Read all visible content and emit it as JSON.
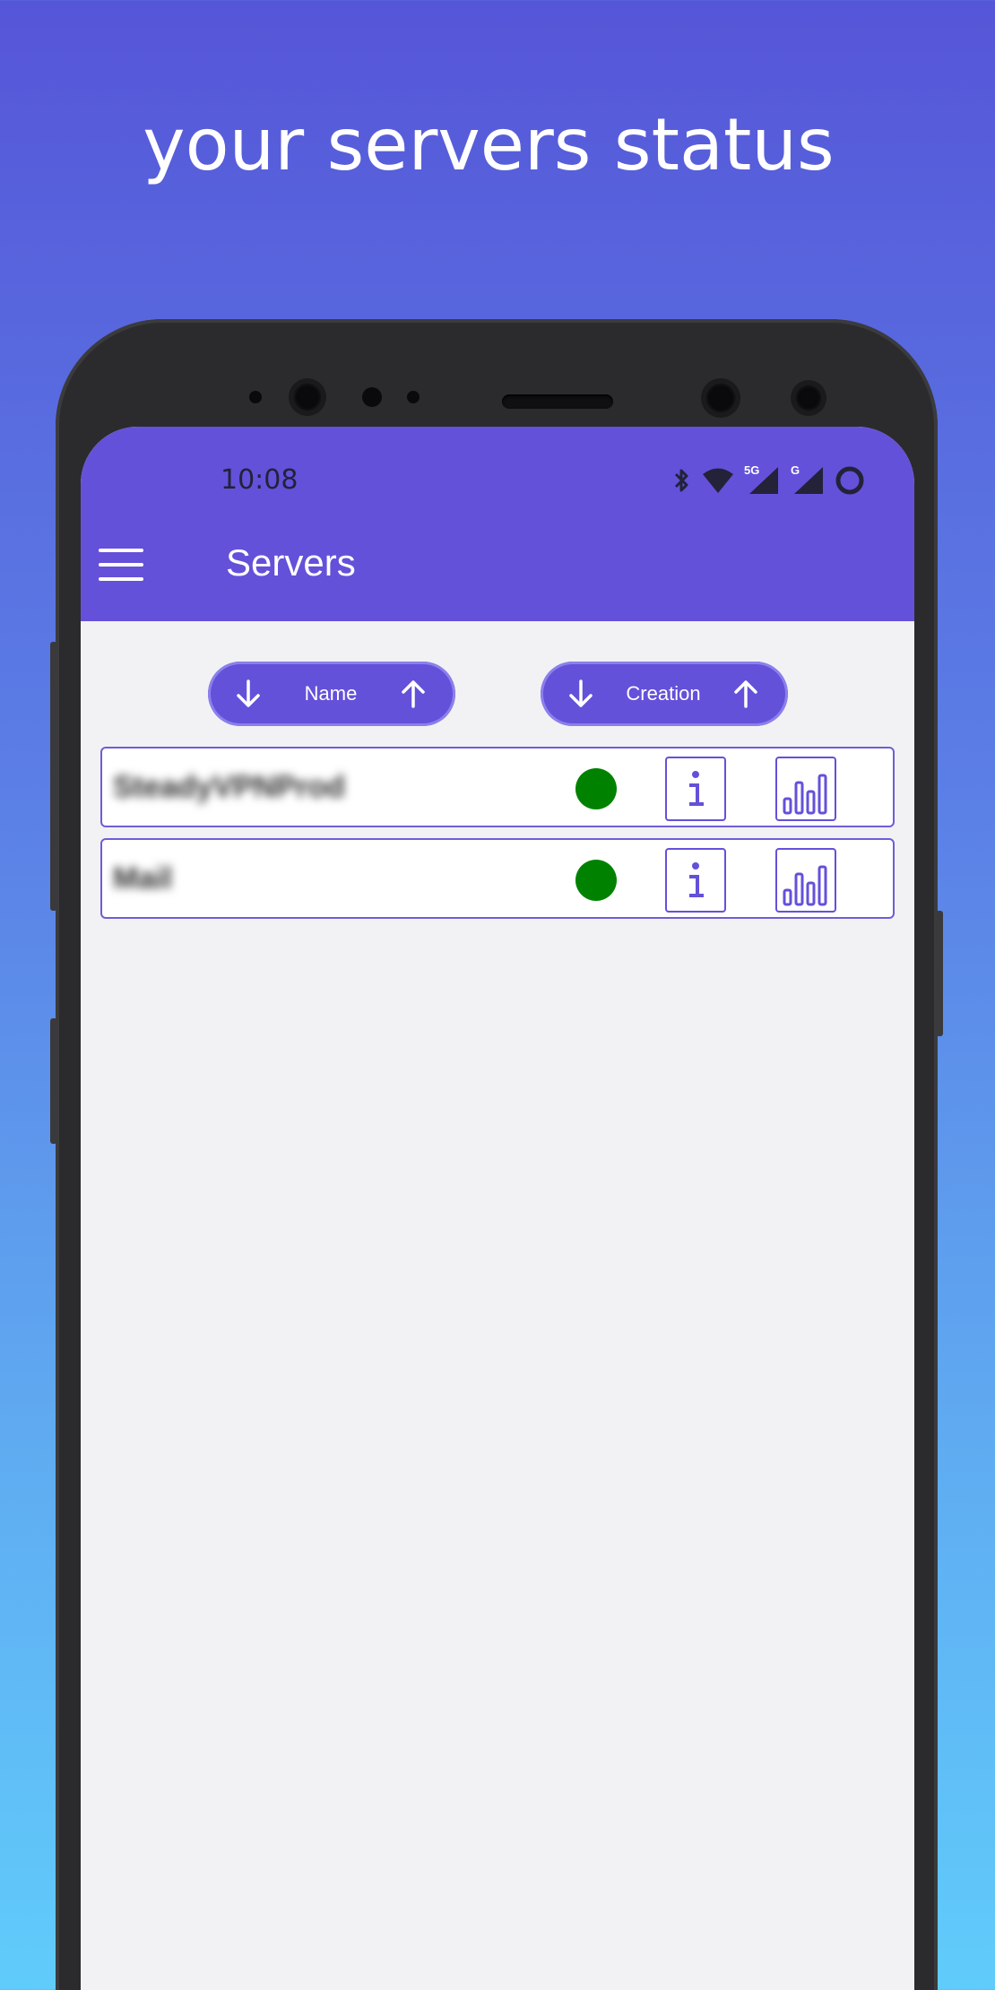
{
  "promo": {
    "headline": "your servers status"
  },
  "status_bar": {
    "time": "10:08",
    "network_label": "5G",
    "network2_label": "G"
  },
  "appbar": {
    "title": "Servers",
    "menu_icon": "hamburger-menu-icon"
  },
  "sort_buttons": [
    {
      "label": "Name",
      "left_icon": "arrow-down-icon",
      "right_icon": "arrow-up-icon"
    },
    {
      "label": "Creation",
      "left_icon": "arrow-down-icon",
      "right_icon": "arrow-up-icon"
    }
  ],
  "servers": [
    {
      "name": "SteadyVPNProd",
      "status": "online",
      "status_color": "#008200"
    },
    {
      "name": "Mail",
      "status": "online",
      "status_color": "#008200"
    }
  ],
  "colors": {
    "accent": "#6351da",
    "status_online": "#008200",
    "screen_bg": "#f2f2f4"
  }
}
